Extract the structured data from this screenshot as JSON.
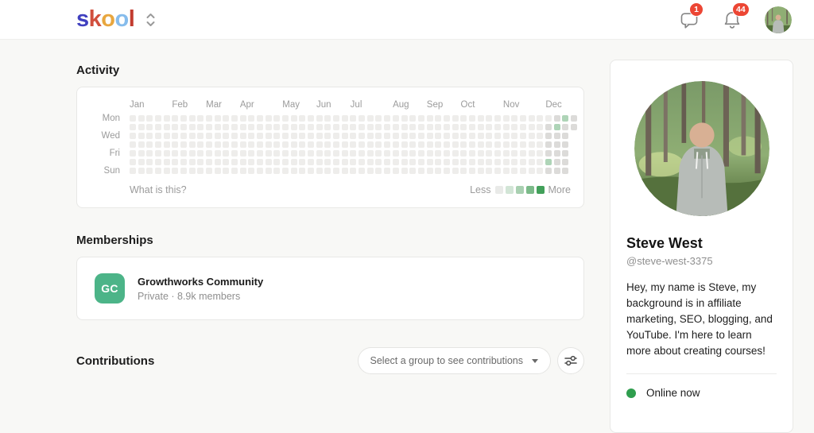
{
  "header": {
    "logo_letters": [
      {
        "ch": "s",
        "color": "#4040bf"
      },
      {
        "ch": "k",
        "color": "#d14f3d"
      },
      {
        "ch": "o",
        "color": "#e8a63e"
      },
      {
        "ch": "o",
        "color": "#86bcec"
      },
      {
        "ch": "l",
        "color": "#c23b2f"
      }
    ],
    "chat_badge": "1",
    "notifications_badge": "44",
    "badge_color": "#ec4634"
  },
  "activity": {
    "title": "Activity",
    "footer_link": "What is this?",
    "legend": {
      "less_label": "Less",
      "more_label": "More",
      "colors": [
        "#e9eae8",
        "#d2e5d6",
        "#a9d0b1",
        "#7bba89",
        "#42a05a"
      ]
    },
    "heatmap": {
      "day_labels": [
        {
          "label": "Mon",
          "row": 1
        },
        {
          "label": "Wed",
          "row": 3
        },
        {
          "label": "Fri",
          "row": 5
        },
        {
          "label": "Sun",
          "row": 7
        }
      ],
      "months": [
        {
          "label": "Jan",
          "week": 1
        },
        {
          "label": "Feb",
          "week": 6
        },
        {
          "label": "Mar",
          "week": 10
        },
        {
          "label": "Apr",
          "week": 14
        },
        {
          "label": "May",
          "week": 19
        },
        {
          "label": "Jun",
          "week": 23
        },
        {
          "label": "Jul",
          "week": 27
        },
        {
          "label": "Aug",
          "week": 32
        },
        {
          "label": "Sep",
          "week": 36
        },
        {
          "label": "Oct",
          "week": 40
        },
        {
          "label": "Nov",
          "week": 45
        },
        {
          "label": "Dec",
          "week": 50
        }
      ],
      "weeks_total": 53,
      "week_default": "0000000",
      "week_overrides": {
        "50": "0111121",
        "51": "1211111",
        "52": "2111111",
        "53": "11xxxxx"
      },
      "level_colors": {
        "0": "#eeedeb",
        "1": "#dcdbd9",
        "2": "#aed4b7",
        "x": "transparent"
      }
    }
  },
  "memberships": {
    "title": "Memberships",
    "items": [
      {
        "initials": "GC",
        "name": "Growthworks Community",
        "meta": "Private · 8.9k members",
        "tile_color": "#4cb488"
      }
    ]
  },
  "contributions": {
    "title": "Contributions",
    "dropdown_label": "Select a group to see contributions"
  },
  "profile": {
    "name": "Steve West",
    "handle": "@steve-west-3375",
    "bio": "Hey, my name is Steve, my background is in affiliate marketing, SEO, blogging, and YouTube. I'm here to learn more about creating courses!",
    "status": "Online now",
    "status_color": "#2f9e4e"
  }
}
